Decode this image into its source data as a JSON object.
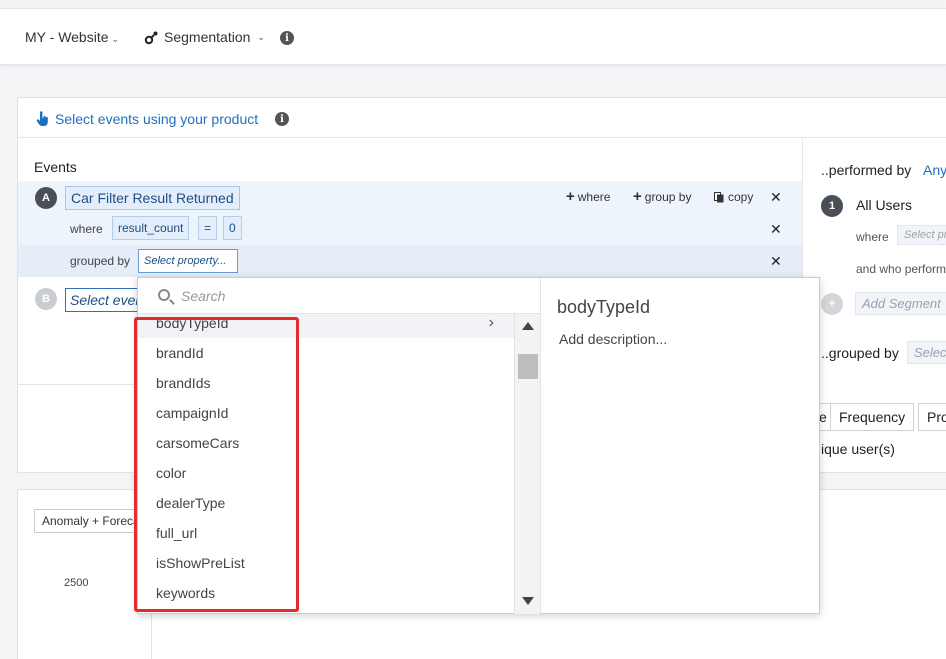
{
  "topbar": {
    "project": "MY - Website",
    "report": "Segmentation"
  },
  "panel": {
    "select_events_link": "Select events using your product",
    "events_label": "Events",
    "event_a": {
      "badge": "A",
      "name": "Car Filter Result Returned",
      "where_action": "where",
      "group_by_action": "group by",
      "copy_action": "copy",
      "where_label": "where",
      "filter_property": "result_count",
      "filter_operator": "=",
      "filter_value": "0",
      "grouped_by_label": "grouped by",
      "grouped_by_placeholder": "Select property..."
    },
    "event_b": {
      "badge": "B",
      "placeholder": "Select event"
    }
  },
  "right_col": {
    "performed_by": "..performed by",
    "performed_by_value": "Any",
    "segment_badge": "1",
    "segment_name": "All Users",
    "where_label": "where",
    "where_placeholder": "Select pr",
    "who_performed": "and who perform",
    "add_segment": "Add Segment",
    "grouped_by": "..grouped by",
    "grouped_by_placeholder": "Selec",
    "tabs": [
      "e",
      "Frequency",
      "Pro"
    ],
    "metric": "ique user(s)"
  },
  "chart": {
    "mode_select": "Anomaly + Forecast",
    "y_tick": "2500"
  },
  "dropdown": {
    "search_placeholder": "Search",
    "items": [
      "bodyTypeId",
      "brandId",
      "brandIds",
      "campaignId",
      "carsomeCars",
      "color",
      "dealerType",
      "full_url",
      "isShowPreList",
      "keywords"
    ],
    "detail_title": "bodyTypeId",
    "detail_description": "Add description..."
  },
  "colors": {
    "link_blue": "#1f6fbf",
    "highlight_red": "#e42b2b"
  }
}
